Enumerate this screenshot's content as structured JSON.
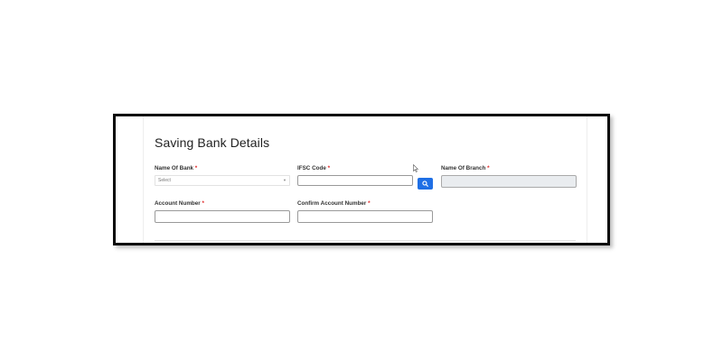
{
  "section": {
    "title": "Saving Bank Details"
  },
  "fields": {
    "bank_name": {
      "label": "Name Of Bank",
      "required_mark": "*",
      "placeholder": "Select",
      "caret": "▼"
    },
    "ifsc_code": {
      "label": "IFSC Code",
      "required_mark": "*",
      "value": ""
    },
    "branch_name": {
      "label": "Name Of Branch",
      "required_mark": "*",
      "value": ""
    },
    "account_number": {
      "label": "Account Number",
      "required_mark": "*",
      "value": ""
    },
    "confirm_account_number": {
      "label": "Confirm Account Number",
      "required_mark": "*",
      "value": ""
    }
  },
  "icons": {
    "search": "search-icon",
    "pointer": "mouse-pointer-icon",
    "search_button_color": "#1f6fe5"
  }
}
